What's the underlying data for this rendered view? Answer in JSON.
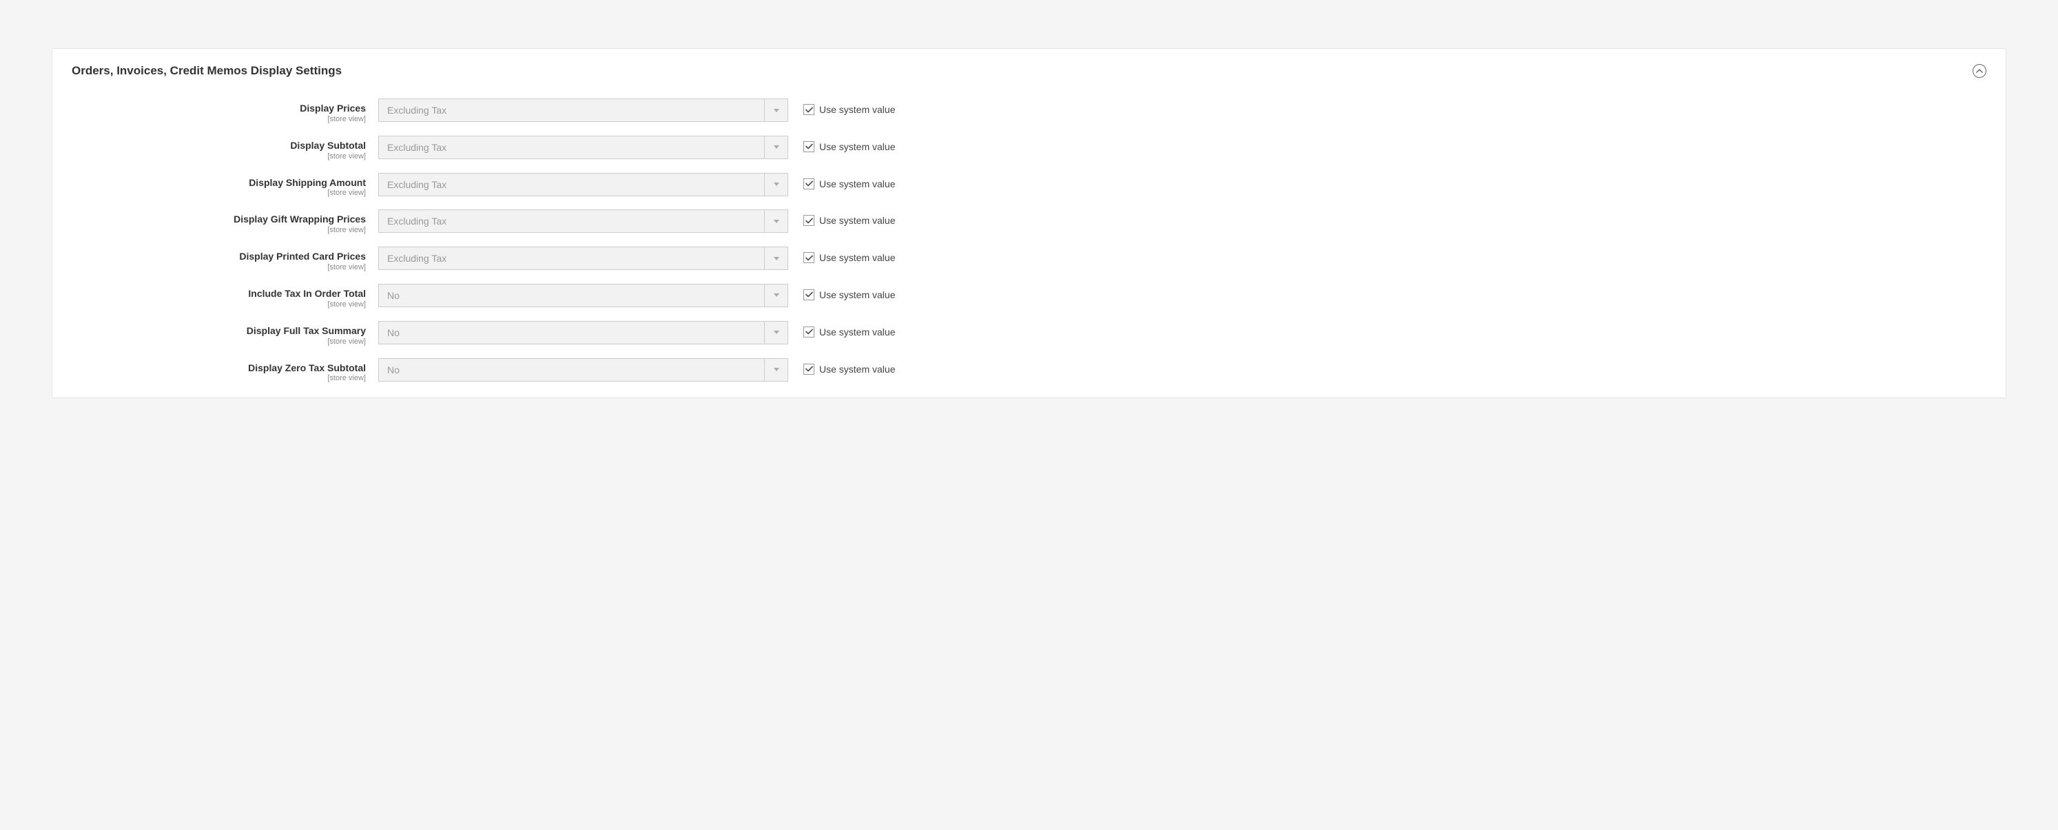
{
  "section": {
    "title": "Orders, Invoices, Credit Memos Display Settings"
  },
  "scope_label": "[store view]",
  "use_system_value_label": "Use system value",
  "fields": [
    {
      "label": "Display Prices",
      "value": "Excluding Tax",
      "use_system": true
    },
    {
      "label": "Display Subtotal",
      "value": "Excluding Tax",
      "use_system": true
    },
    {
      "label": "Display Shipping Amount",
      "value": "Excluding Tax",
      "use_system": true
    },
    {
      "label": "Display Gift Wrapping Prices",
      "value": "Excluding Tax",
      "use_system": true
    },
    {
      "label": "Display Printed Card Prices",
      "value": "Excluding Tax",
      "use_system": true
    },
    {
      "label": "Include Tax In Order Total",
      "value": "No",
      "use_system": true
    },
    {
      "label": "Display Full Tax Summary",
      "value": "No",
      "use_system": true
    },
    {
      "label": "Display Zero Tax Subtotal",
      "value": "No",
      "use_system": true
    }
  ]
}
